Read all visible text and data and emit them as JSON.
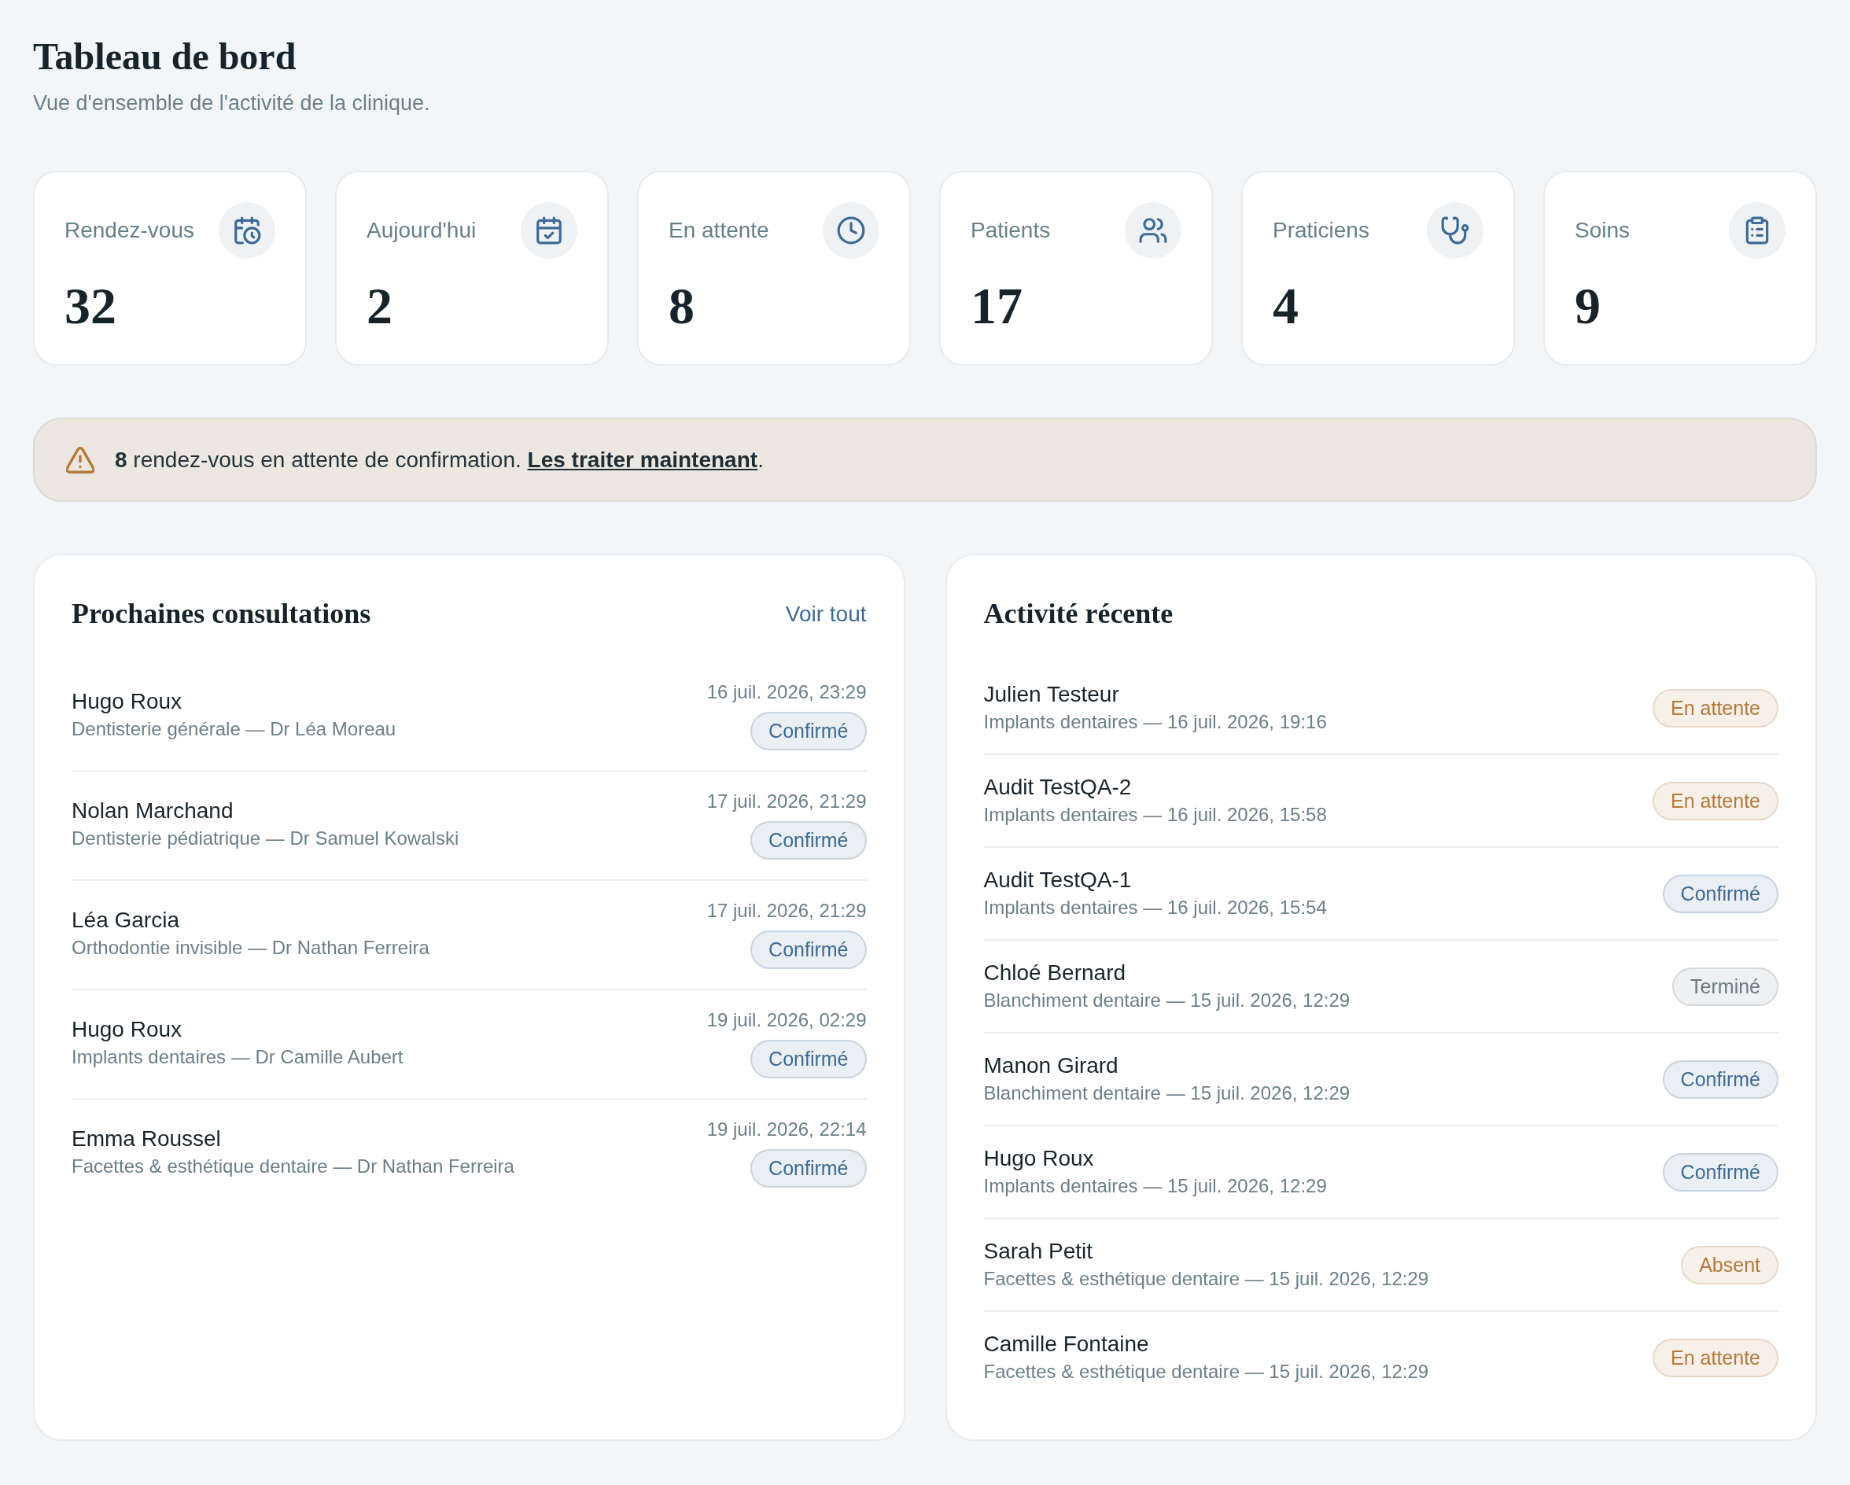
{
  "header": {
    "title": "Tableau de bord",
    "subtitle": "Vue d'ensemble de l'activité de la clinique."
  },
  "stats": [
    {
      "label": "Rendez-vous",
      "value": "32",
      "kind": "appointments"
    },
    {
      "label": "Aujourd'hui",
      "value": "2",
      "kind": "today"
    },
    {
      "label": "En attente",
      "value": "8",
      "kind": "pending"
    },
    {
      "label": "Patients",
      "value": "17",
      "kind": "patients"
    },
    {
      "label": "Praticiens",
      "value": "4",
      "kind": "practitioners"
    },
    {
      "label": "Soins",
      "value": "9",
      "kind": "treatments"
    }
  ],
  "alert": {
    "message": "**8** rendez-vous en attente de confirmation.",
    "link": "Les traiter maintenant",
    "end": "."
  },
  "upcoming": {
    "title": "Prochaines consultations",
    "link": "Voir tout",
    "items": [
      {
        "name": "Hugo Roux",
        "details": "Dentisterie générale — Dr Léa Moreau",
        "date": "16 juil. 2026, 23:29",
        "status": {
          "label": "Confirmé",
          "color": "#3d6a96"
        }
      },
      {
        "name": "Nolan Marchand",
        "details": "Dentisterie pédiatrique — Dr Samuel Kowalski",
        "date": "17 juil. 2026, 21:29",
        "status": {
          "label": "Confirmé",
          "color": "#3d6a96"
        }
      },
      {
        "name": "Léa Garcia",
        "details": "Orthodontie invisible — Dr Nathan Ferreira",
        "date": "17 juil. 2026, 21:29",
        "status": {
          "label": "Confirmé",
          "color": "#3d6a96"
        }
      },
      {
        "name": "Hugo Roux",
        "details": "Implants dentaires — Dr Camille Aubert",
        "date": "19 juil. 2026, 02:29",
        "status": {
          "label": "Confirmé",
          "color": "#3d6a96"
        }
      },
      {
        "name": "Emma Roussel",
        "details": "Facettes & esthétique dentaire — Dr Nathan Ferreira",
        "date": "19 juil. 2026, 22:14",
        "status": {
          "label": "Confirmé",
          "color": "#3d6a96"
        }
      }
    ]
  },
  "activity": {
    "title": "Activité récente",
    "items": [
      {
        "name": "Julien Testeur",
        "details": "Implants dentaires — 16 juil. 2026, 19:16",
        "status": {
          "label": "En attente",
          "color": "#b5793a"
        }
      },
      {
        "name": "Audit TestQA-2",
        "details": "Implants dentaires — 16 juil. 2026, 15:58",
        "status": {
          "label": "En attente",
          "color": "#b5793a"
        }
      },
      {
        "name": "Audit TestQA-1",
        "details": "Implants dentaires — 16 juil. 2026, 15:54",
        "status": {
          "label": "Confirmé",
          "color": "#3d6a96"
        }
      },
      {
        "name": "Chloé Bernard",
        "details": "Blanchiment dentaire — 15 juil. 2026, 12:29",
        "status": {
          "label": "Terminé",
          "color": "#6b7a82"
        }
      },
      {
        "name": "Manon Girard",
        "details": "Blanchiment dentaire — 15 juil. 2026, 12:29",
        "status": {
          "label": "Confirmé",
          "color": "#3d6a96"
        }
      },
      {
        "name": "Hugo Roux",
        "details": "Implants dentaires — 15 juil. 2026, 12:29",
        "status": {
          "label": "Confirmé",
          "color": "#3d6a96"
        }
      },
      {
        "name": "Sarah Petit",
        "details": "Facettes & esthétique dentaire — 15 juil. 2026, 12:29",
        "status": {
          "label": "Absent",
          "color": "#b5793a"
        }
      },
      {
        "name": "Camille Fontaine",
        "details": "Facettes & esthétique dentaire — 15 juil. 2026, 12:29",
        "status": {
          "label": "En attente",
          "color": "#b5793a"
        }
      }
    ]
  }
}
